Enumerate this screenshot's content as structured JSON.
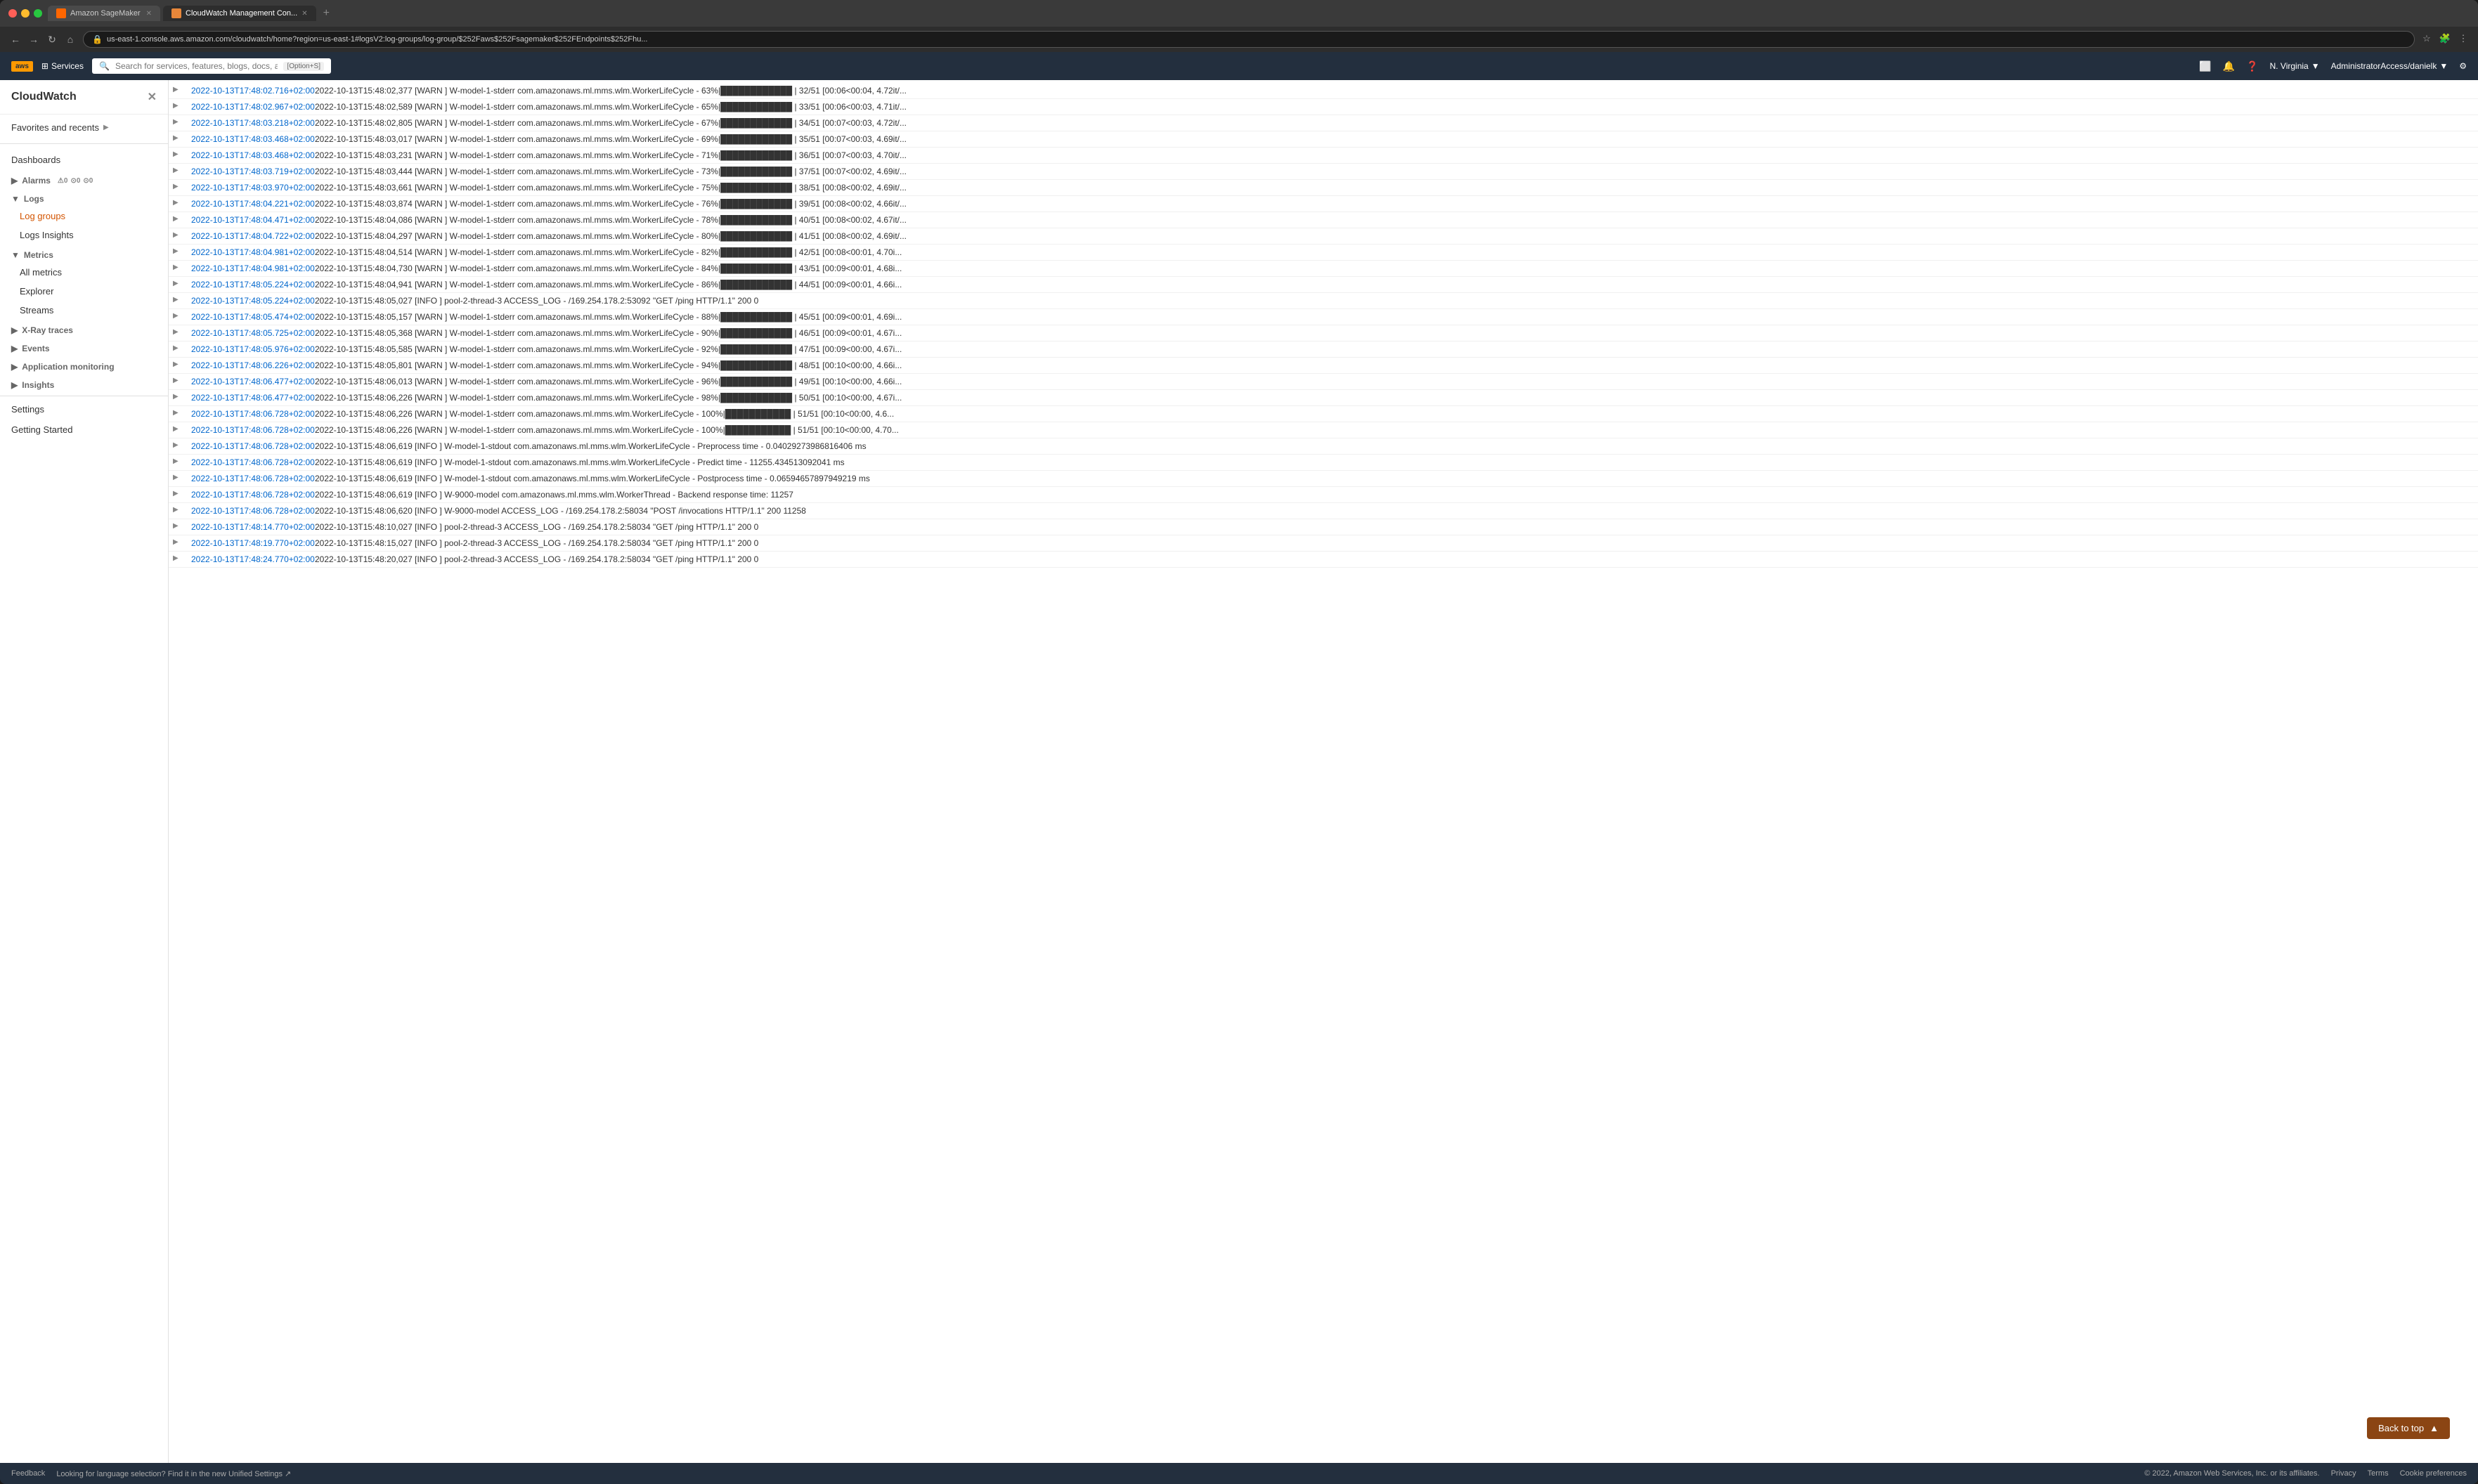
{
  "browser": {
    "tabs": [
      {
        "id": "sagemaker",
        "label": "Amazon SageMaker",
        "active": false,
        "favicon": "sm"
      },
      {
        "id": "cloudwatch",
        "label": "CloudWatch Management Con...",
        "active": true,
        "favicon": "cw"
      }
    ],
    "url": "us-east-1.console.aws.amazon.com/cloudwatch/home?region=us-east-1#logsV2:log-groups/log-group/$252Faws$252Fsagemaker$252FEndpoints$252Fhu...",
    "add_tab_label": "+"
  },
  "nav": {
    "back": "←",
    "forward": "→",
    "refresh": "↻",
    "home": "⌂"
  },
  "aws_topnav": {
    "logo": "aws",
    "services_label": "Services",
    "search_placeholder": "Search for services, features, blogs, docs, and more",
    "search_shortcut": "[Option+S]",
    "icons": [
      "☰",
      "🔔",
      "❓"
    ],
    "region": "N. Virginia",
    "user": "AdministratorAccess/danielk"
  },
  "sidebar": {
    "title": "CloudWatch",
    "close_icon": "✕",
    "items": {
      "favorites_label": "Favorites and recents",
      "dashboards": "Dashboards",
      "alarms_label": "Alarms",
      "alarms_badge_warn": "⚠0",
      "alarms_badge_ok": "⊙0",
      "alarms_badge_alarm": "⊙0",
      "logs_label": "Logs",
      "log_groups": "Log groups",
      "logs_insights": "Logs Insights",
      "metrics_label": "Metrics",
      "all_metrics": "All metrics",
      "explorer": "Explorer",
      "streams": "Streams",
      "xray_label": "X-Ray traces",
      "events_label": "Events",
      "app_monitoring_label": "Application monitoring",
      "insights_label": "Insights",
      "settings": "Settings",
      "getting_started": "Getting Started"
    }
  },
  "log_entries": [
    {
      "timestamp": "2022-10-13T17:48:02.716+02:00",
      "message": "2022-10-13T15:48:02,377 [WARN ] W-model-1-stderr com.amazonaws.ml.mms.wlm.WorkerLifeCycle - 63%|████████████ | 32/51 [00:06<00:04, 4.72it/..."
    },
    {
      "timestamp": "2022-10-13T17:48:02.967+02:00",
      "message": "2022-10-13T15:48:02,589 [WARN ] W-model-1-stderr com.amazonaws.ml.mms.wlm.WorkerLifeCycle - 65%|████████████ | 33/51 [00:06<00:03, 4.71it/..."
    },
    {
      "timestamp": "2022-10-13T17:48:03.218+02:00",
      "message": "2022-10-13T15:48:02,805 [WARN ] W-model-1-stderr com.amazonaws.ml.mms.wlm.WorkerLifeCycle - 67%|████████████ | 34/51 [00:07<00:03, 4.72it/..."
    },
    {
      "timestamp": "2022-10-13T17:48:03.468+02:00",
      "message": "2022-10-13T15:48:03,017 [WARN ] W-model-1-stderr com.amazonaws.ml.mms.wlm.WorkerLifeCycle - 69%|████████████ | 35/51 [00:07<00:03, 4.69it/..."
    },
    {
      "timestamp": "2022-10-13T17:48:03.468+02:00",
      "message": "2022-10-13T15:48:03,231 [WARN ] W-model-1-stderr com.amazonaws.ml.mms.wlm.WorkerLifeCycle - 71%|████████████ | 36/51 [00:07<00:03, 4.70it/..."
    },
    {
      "timestamp": "2022-10-13T17:48:03.719+02:00",
      "message": "2022-10-13T15:48:03,444 [WARN ] W-model-1-stderr com.amazonaws.ml.mms.wlm.WorkerLifeCycle - 73%|████████████ | 37/51 [00:07<00:02, 4.69it/..."
    },
    {
      "timestamp": "2022-10-13T17:48:03.970+02:00",
      "message": "2022-10-13T15:48:03,661 [WARN ] W-model-1-stderr com.amazonaws.ml.mms.wlm.WorkerLifeCycle - 75%|████████████ | 38/51 [00:08<00:02, 4.69it/..."
    },
    {
      "timestamp": "2022-10-13T17:48:04.221+02:00",
      "message": "2022-10-13T15:48:03,874 [WARN ] W-model-1-stderr com.amazonaws.ml.mms.wlm.WorkerLifeCycle - 76%|████████████ | 39/51 [00:08<00:02, 4.66it/..."
    },
    {
      "timestamp": "2022-10-13T17:48:04.471+02:00",
      "message": "2022-10-13T15:48:04,086 [WARN ] W-model-1-stderr com.amazonaws.ml.mms.wlm.WorkerLifeCycle - 78%|████████████ | 40/51 [00:08<00:02, 4.67it/..."
    },
    {
      "timestamp": "2022-10-13T17:48:04.722+02:00",
      "message": "2022-10-13T15:48:04,297 [WARN ] W-model-1-stderr com.amazonaws.ml.mms.wlm.WorkerLifeCycle - 80%|████████████ | 41/51 [00:08<00:02, 4.69it/..."
    },
    {
      "timestamp": "2022-10-13T17:48:04.981+02:00",
      "message": "2022-10-13T15:48:04,514 [WARN ] W-model-1-stderr com.amazonaws.ml.mms.wlm.WorkerLifeCycle - 82%|████████████ | 42/51 [00:08<00:01, 4.70i..."
    },
    {
      "timestamp": "2022-10-13T17:48:04.981+02:00",
      "message": "2022-10-13T15:48:04,730 [WARN ] W-model-1-stderr com.amazonaws.ml.mms.wlm.WorkerLifeCycle - 84%|████████████ | 43/51 [00:09<00:01, 4.68i..."
    },
    {
      "timestamp": "2022-10-13T17:48:05.224+02:00",
      "message": "2022-10-13T15:48:04,941 [WARN ] W-model-1-stderr com.amazonaws.ml.mms.wlm.WorkerLifeCycle - 86%|████████████ | 44/51 [00:09<00:01, 4.66i..."
    },
    {
      "timestamp": "2022-10-13T17:48:05.224+02:00",
      "message": "2022-10-13T15:48:05,027 [INFO ] pool-2-thread-3 ACCESS_LOG - /169.254.178.2:53092 \"GET /ping HTTP/1.1\" 200 0"
    },
    {
      "timestamp": "2022-10-13T17:48:05.474+02:00",
      "message": "2022-10-13T15:48:05,157 [WARN ] W-model-1-stderr com.amazonaws.ml.mms.wlm.WorkerLifeCycle - 88%|████████████ | 45/51 [00:09<00:01, 4.69i..."
    },
    {
      "timestamp": "2022-10-13T17:48:05.725+02:00",
      "message": "2022-10-13T15:48:05,368 [WARN ] W-model-1-stderr com.amazonaws.ml.mms.wlm.WorkerLifeCycle - 90%|████████████ | 46/51 [00:09<00:01, 4.67i..."
    },
    {
      "timestamp": "2022-10-13T17:48:05.976+02:00",
      "message": "2022-10-13T15:48:05,585 [WARN ] W-model-1-stderr com.amazonaws.ml.mms.wlm.WorkerLifeCycle - 92%|████████████ | 47/51 [00:09<00:00, 4.67i..."
    },
    {
      "timestamp": "2022-10-13T17:48:06.226+02:00",
      "message": "2022-10-13T15:48:05,801 [WARN ] W-model-1-stderr com.amazonaws.ml.mms.wlm.WorkerLifeCycle - 94%|████████████ | 48/51 [00:10<00:00, 4.66i..."
    },
    {
      "timestamp": "2022-10-13T17:48:06.477+02:00",
      "message": "2022-10-13T15:48:06,013 [WARN ] W-model-1-stderr com.amazonaws.ml.mms.wlm.WorkerLifeCycle - 96%|████████████ | 49/51 [00:10<00:00, 4.66i..."
    },
    {
      "timestamp": "2022-10-13T17:48:06.477+02:00",
      "message": "2022-10-13T15:48:06,226 [WARN ] W-model-1-stderr com.amazonaws.ml.mms.wlm.WorkerLifeCycle - 98%|████████████ | 50/51 [00:10<00:00, 4.67i..."
    },
    {
      "timestamp": "2022-10-13T17:48:06.728+02:00",
      "message": "2022-10-13T15:48:06,226 [WARN ] W-model-1-stderr com.amazonaws.ml.mms.wlm.WorkerLifeCycle - 100%|███████████ | 51/51 [00:10<00:00, 4.6..."
    },
    {
      "timestamp": "2022-10-13T17:48:06.728+02:00",
      "message": "2022-10-13T15:48:06,226 [WARN ] W-model-1-stderr com.amazonaws.ml.mms.wlm.WorkerLifeCycle - 100%|███████████ | 51/51 [00:10<00:00, 4.70..."
    },
    {
      "timestamp": "2022-10-13T17:48:06.728+02:00",
      "message": "2022-10-13T15:48:06,619 [INFO ] W-model-1-stdout com.amazonaws.ml.mms.wlm.WorkerLifeCycle - Preprocess time - 0.04029273986816406 ms"
    },
    {
      "timestamp": "2022-10-13T17:48:06.728+02:00",
      "message": "2022-10-13T15:48:06,619 [INFO ] W-model-1-stdout com.amazonaws.ml.mms.wlm.WorkerLifeCycle - Predict time - 11255.434513092041 ms"
    },
    {
      "timestamp": "2022-10-13T17:48:06.728+02:00",
      "message": "2022-10-13T15:48:06,619 [INFO ] W-model-1-stdout com.amazonaws.ml.mms.wlm.WorkerLifeCycle - Postprocess time - 0.06594657897949219 ms"
    },
    {
      "timestamp": "2022-10-13T17:48:06.728+02:00",
      "message": "2022-10-13T15:48:06,619 [INFO ] W-9000-model com.amazonaws.ml.mms.wlm.WorkerThread - Backend response time: 11257"
    },
    {
      "timestamp": "2022-10-13T17:48:06.728+02:00",
      "message": "2022-10-13T15:48:06,620 [INFO ] W-9000-model ACCESS_LOG - /169.254.178.2:58034 \"POST /invocations HTTP/1.1\" 200 11258"
    },
    {
      "timestamp": "2022-10-13T17:48:14.770+02:00",
      "message": "2022-10-13T15:48:10,027 [INFO ] pool-2-thread-3 ACCESS_LOG - /169.254.178.2:58034 \"GET /ping HTTP/1.1\" 200 0"
    },
    {
      "timestamp": "2022-10-13T17:48:19.770+02:00",
      "message": "2022-10-13T15:48:15,027 [INFO ] pool-2-thread-3 ACCESS_LOG - /169.254.178.2:58034 \"GET /ping HTTP/1.1\" 200 0"
    },
    {
      "timestamp": "2022-10-13T17:48:24.770+02:00",
      "message": "2022-10-13T15:48:20,027 [INFO ] pool-2-thread-3 ACCESS_LOG - /169.254.178.2:58034 \"GET /ping HTTP/1.1\" 200 0"
    }
  ],
  "back_to_top": "Back to top",
  "footer": {
    "feedback": "Feedback",
    "language_msg": "Looking for language selection? Find it in the new",
    "unified_settings": "Unified Settings",
    "copyright": "© 2022, Amazon Web Services, Inc. or its affiliates.",
    "privacy": "Privacy",
    "terms": "Terms",
    "cookie_preferences": "Cookie preferences"
  }
}
